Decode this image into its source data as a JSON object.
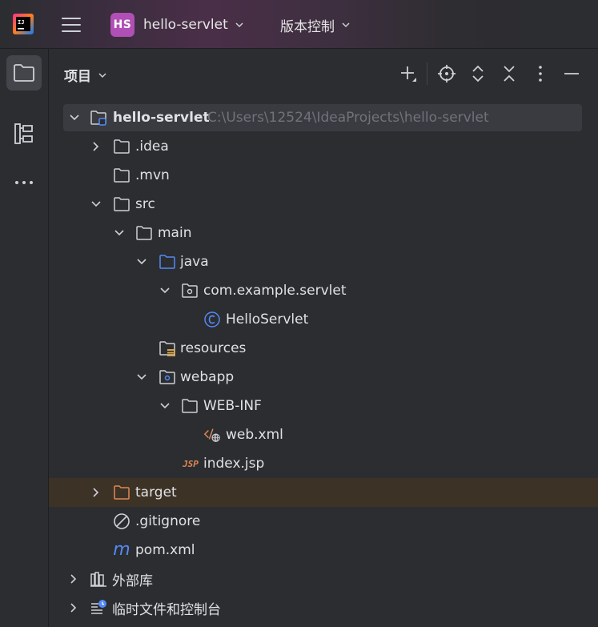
{
  "titlebar": {
    "app_icon": "intellij-idea-icon",
    "menu_icon": "hamburger-menu-icon",
    "project_badge": "HS",
    "project_name": "hello-servlet",
    "vcs_label": "版本控制",
    "badge_color": "#b04fb5"
  },
  "toolstrip": {
    "items": [
      {
        "icon": "folder-icon",
        "active": true
      },
      {
        "icon": "structure-icon",
        "active": false
      },
      {
        "icon": "more-icon",
        "active": false
      }
    ]
  },
  "panel": {
    "title": "项目",
    "actions": [
      "add-icon",
      "locate-icon",
      "expand-all-icon",
      "collapse-all-icon",
      "options-icon",
      "hide-icon"
    ]
  },
  "tree": {
    "root": {
      "label": "hello-servlet",
      "path": "C:\\Users\\12524\\IdeaProjects\\hello-servlet"
    },
    "idea": ".idea",
    "mvn": ".mvn",
    "src": "src",
    "main": "main",
    "java": "java",
    "package": "com.example.servlet",
    "class": "HelloServlet",
    "resources": "resources",
    "webapp": "webapp",
    "webinf": "WEB-INF",
    "webxml": "web.xml",
    "jsp_badge": "JSP",
    "indexjsp": "index.jsp",
    "target": "target",
    "gitignore": ".gitignore",
    "maven_badge": "m",
    "pom": "pom.xml",
    "libs": "外部库",
    "scratches": "临时文件和控制台"
  },
  "colors": {
    "accent": "#548af7",
    "excluded_folder": "#e08855",
    "excluded_row": "#3c3226"
  }
}
